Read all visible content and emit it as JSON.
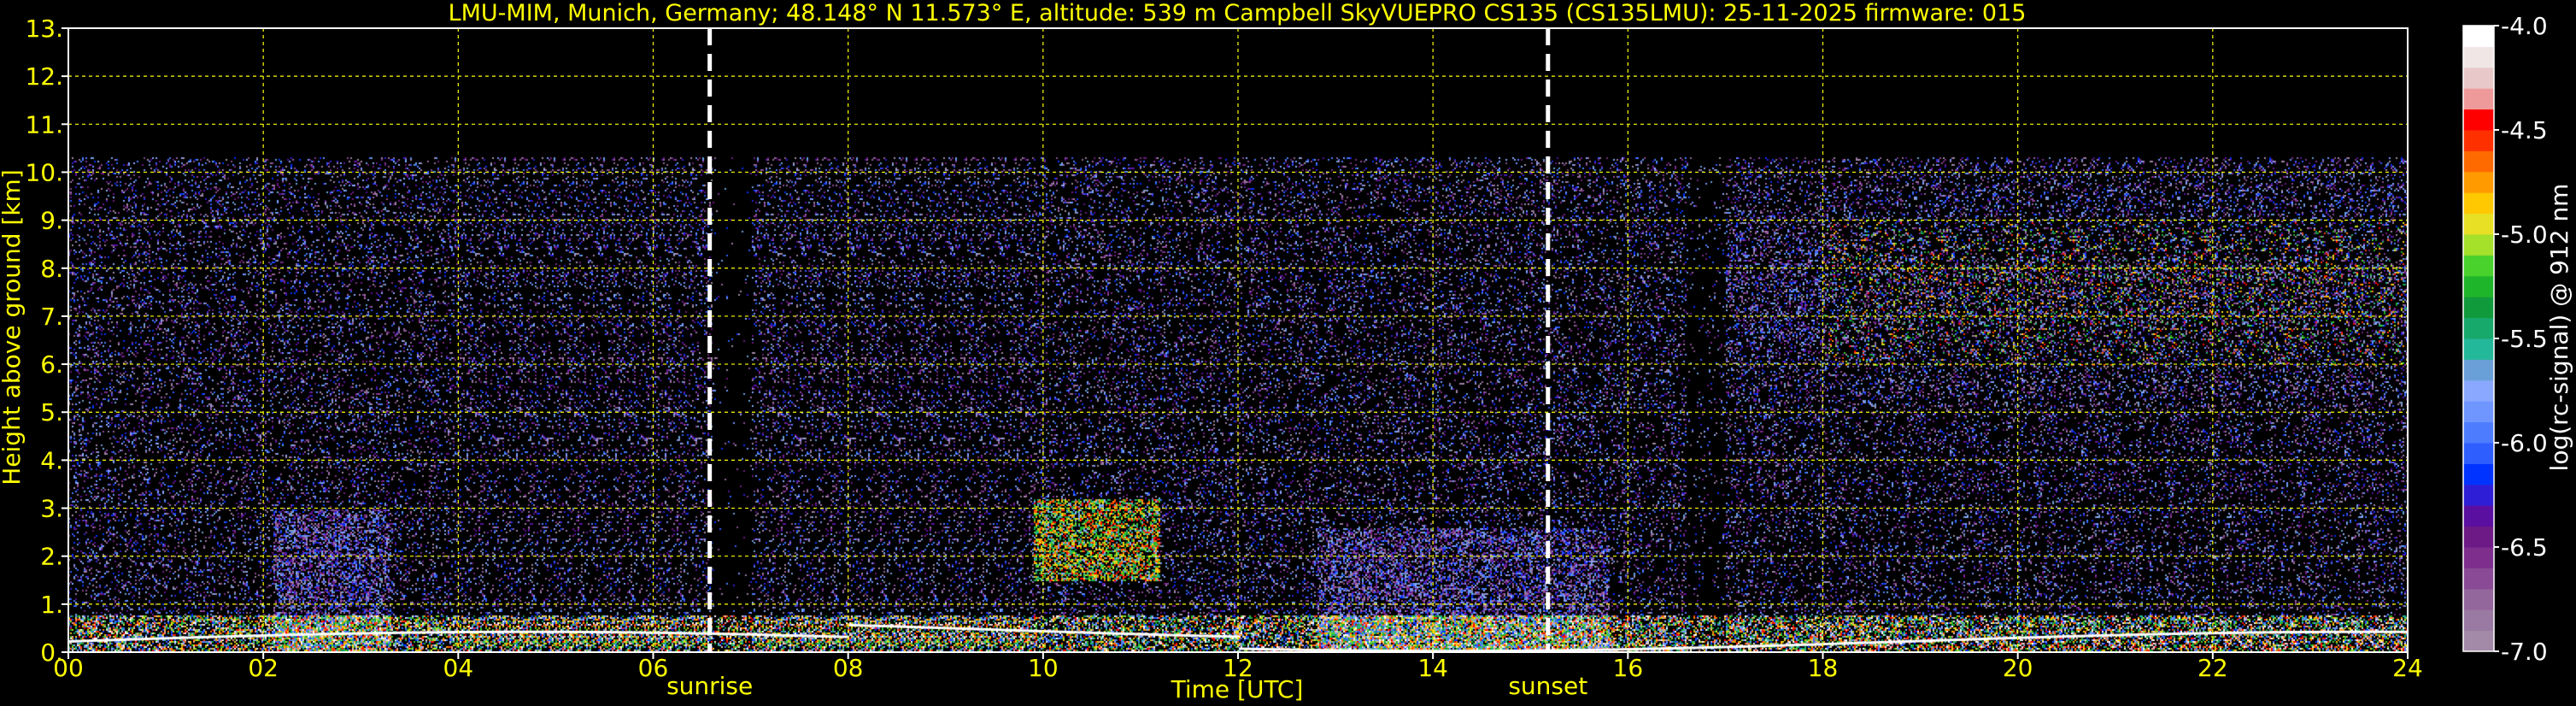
{
  "chart_data": {
    "type": "heatmap",
    "title": "LMU-MIM, Munich, Germany; 48.148° N 11.573° E, altitude: 539 m    Campbell SkyVUEPRO CS135 (CS135LMU): 25-11-2025    firmware: 015",
    "xlabel": "Time [UTC]",
    "ylabel": "Height above ground [km]",
    "xlim": [
      0,
      24
    ],
    "ylim": [
      0,
      13
    ],
    "xticks": [
      0,
      2,
      4,
      6,
      8,
      10,
      12,
      14,
      16,
      18,
      20,
      22,
      24
    ],
    "xtick_labels": [
      "00",
      "02",
      "04",
      "06",
      "08",
      "10",
      "12",
      "14",
      "16",
      "18",
      "20",
      "22",
      "24"
    ],
    "yticks": [
      0,
      1,
      2,
      3,
      4,
      5,
      6,
      7,
      8,
      9,
      10,
      11,
      12,
      13
    ],
    "ytick_labels": [
      "0.",
      "1.",
      "2.",
      "3.",
      "4.",
      "5.",
      "6.",
      "7.",
      "8.",
      "9.",
      "10.",
      "11.",
      "12.",
      "13."
    ],
    "grid": true,
    "grid_color": "#ffff00",
    "background": "#000000",
    "annotations": [
      {
        "label": "sunrise",
        "x": 6.58
      },
      {
        "label": "sunset",
        "x": 15.18
      }
    ],
    "data_max_height_km": 10.3,
    "colorbar": {
      "label": "log(rc-signal) @ 912 nm",
      "range": [
        -7.0,
        -4.0
      ],
      "ticks": [
        -7.0,
        -6.5,
        -6.0,
        -5.5,
        -5.0,
        -4.5,
        -4.0
      ],
      "tick_labels": [
        "-7.0",
        "-6.5",
        "-6.0",
        "-5.5",
        "-5.0",
        "-4.5",
        "-4.0"
      ],
      "colors": [
        "#a28aa8",
        "#9a7aa3",
        "#93669c",
        "#8a4a96",
        "#7e2f8e",
        "#6e1a86",
        "#5a0fa0",
        "#2e1fd6",
        "#0033ff",
        "#2f5eff",
        "#4d7cff",
        "#6f95ff",
        "#8aa8ff",
        "#6aa0d8",
        "#23b89a",
        "#17a86b",
        "#119a3b",
        "#1fb52a",
        "#49d22c",
        "#a5e02a",
        "#e8e025",
        "#ffc800",
        "#ff9a00",
        "#ff6a00",
        "#ff3000",
        "#ff0000",
        "#ef9a9a",
        "#e8c8c8",
        "#f0e6e6",
        "#ffffff"
      ]
    }
  }
}
